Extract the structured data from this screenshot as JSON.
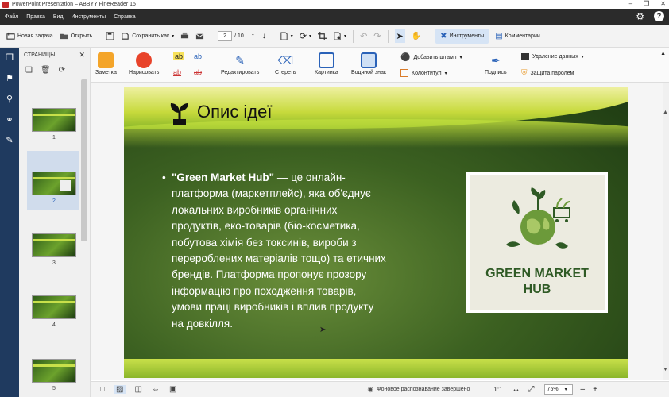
{
  "window": {
    "title": "PowerPoint Presentation – ABBYY FineReader 15"
  },
  "menu": {
    "items": [
      "Файл",
      "Правка",
      "Вид",
      "Инструменты",
      "Справка"
    ]
  },
  "toolbar": {
    "new_task": "Новая задача",
    "open": "Открыть",
    "save_as": "Сохранить как",
    "page_current": "2",
    "page_total": "/ 10",
    "tools": "Инструменты",
    "comments": "Комментарии"
  },
  "ribbon": {
    "note": "Заметка",
    "draw": "Нарисовать",
    "edit": "Редактировать",
    "erase": "Стереть",
    "picture": "Картинка",
    "watermark": "Водяной знак",
    "add_stamp": "Добавить штамп",
    "header_footer": "Колонтитул",
    "signature": "Подпись",
    "remove_data": "Удаление данных",
    "password": "Защита паролем"
  },
  "pages_panel": {
    "title": "СТРАНИЦЫ",
    "numbers": [
      "1",
      "2",
      "3",
      "4",
      "5"
    ]
  },
  "slide": {
    "heading": "Опис ідеї",
    "bullet_bold": "\"Green Market Hub\"",
    "bullet_lines": [
      " — це онлайн-",
      "платформа (маркетплейс), яка об'єднує",
      "локальних виробників органічних",
      "продуктів, еко-товарів (біо-косметика,",
      "побутова хімія без токсинів, вироби з",
      "перероблених матеріалів тощо) та етичних",
      "брендів. Платформа пропонує прозору",
      "інформацію про походження товарів,",
      "умови праці виробників і вплив продукту",
      "на довкілля."
    ],
    "logo_line1": "GREEN MARKET",
    "logo_line2": "HUB"
  },
  "status": {
    "recognition": "Фоновое распознавание завершено",
    "ratio": "1:1",
    "zoom": "75%"
  },
  "colors": {
    "menubar": "#2b2b2b",
    "rail": "#1f3a5f",
    "accent_green": "#2f5a25",
    "band_yellow": "#c7da3c"
  }
}
